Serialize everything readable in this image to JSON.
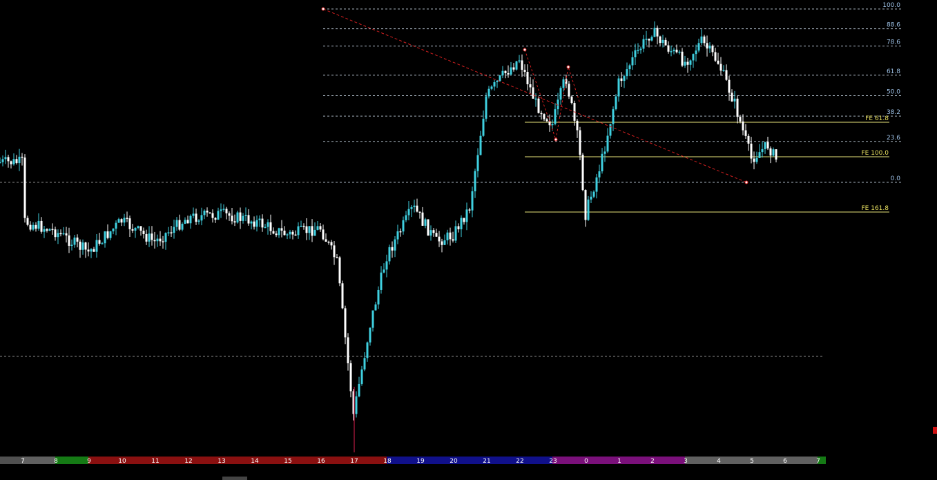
{
  "colors": {
    "background": "#000000",
    "candle_up": "#3fd0e0",
    "candle_down": "#ffffff",
    "fib_line": "#a8b4c0",
    "fib_label": "#9fc3e8",
    "fe_line": "#e8e47a",
    "fe_label": "#e8e060",
    "trend_line": "#d42020",
    "grid_dash": "#8a8a8a",
    "wick_spike": "#e02050"
  },
  "fib_retracement": {
    "levels": [
      "100.0",
      "88.6",
      "78.6",
      "61.8",
      "50.0",
      "38.2",
      "23.6",
      "0.0"
    ],
    "values": [
      100.0,
      88.6,
      78.6,
      61.8,
      50.0,
      38.2,
      23.6,
      0.0
    ]
  },
  "fib_expansion": {
    "levels": [
      "FE 61.8",
      "FE 100.0",
      "FE 161.8"
    ],
    "values": [
      61.8,
      100.0,
      161.8
    ]
  },
  "hour_axis": {
    "labels": [
      "7",
      "8",
      "9",
      "10",
      "11",
      "12",
      "13",
      "14",
      "15",
      "16",
      "17",
      "18",
      "19",
      "20",
      "21",
      "22",
      "23",
      "0",
      "1",
      "2",
      "3",
      "4",
      "5",
      "6",
      "7"
    ],
    "colors": [
      "#606060",
      "#157a15",
      "#8a1010",
      "#8a1010",
      "#8a1010",
      "#8a1010",
      "#8a1010",
      "#8a1010",
      "#8a1010",
      "#8a1010",
      "#8a1010",
      "#10108a",
      "#10108a",
      "#10108a",
      "#10108a",
      "#10108a",
      "#7a107a",
      "#7a107a",
      "#7a107a",
      "#7a107a",
      "#606060",
      "#606060",
      "#606060",
      "#606060",
      "#157a15"
    ]
  },
  "chart_data": {
    "type": "candlestick",
    "x_axis": "hour of day",
    "hours": [
      "7",
      "8",
      "9",
      "10",
      "11",
      "12",
      "13",
      "14",
      "15",
      "16",
      "17",
      "18",
      "19",
      "20",
      "21",
      "22",
      "23",
      "0",
      "1",
      "2",
      "3",
      "4",
      "5",
      "6",
      "7"
    ],
    "price_path": [
      [
        7,
        320
      ],
      [
        8,
        335
      ],
      [
        9,
        365
      ],
      [
        10,
        320
      ],
      [
        11,
        350
      ],
      [
        12,
        315
      ],
      [
        13,
        310
      ],
      [
        14,
        320
      ],
      [
        15,
        340
      ],
      [
        16,
        330
      ],
      [
        16.5,
        380
      ],
      [
        17,
        600
      ],
      [
        17.5,
        470
      ],
      [
        18,
        370
      ],
      [
        18.8,
        300
      ],
      [
        19.5,
        350
      ],
      [
        20,
        340
      ],
      [
        20.5,
        300
      ],
      [
        21,
        140
      ],
      [
        21.5,
        110
      ],
      [
        22,
        85
      ],
      [
        22.5,
        150
      ],
      [
        23,
        180
      ],
      [
        23.4,
        110
      ],
      [
        23.8,
        210
      ],
      [
        24,
        310
      ],
      [
        24.5,
        230
      ],
      [
        25,
        120
      ],
      [
        25.5,
        80
      ],
      [
        26,
        45
      ],
      [
        26.5,
        70
      ],
      [
        27,
        90
      ],
      [
        27.5,
        60
      ],
      [
        28,
        90
      ],
      [
        28.5,
        150
      ],
      [
        29,
        230
      ],
      [
        29.5,
        210
      ],
      [
        29.8,
        235
      ]
    ]
  }
}
